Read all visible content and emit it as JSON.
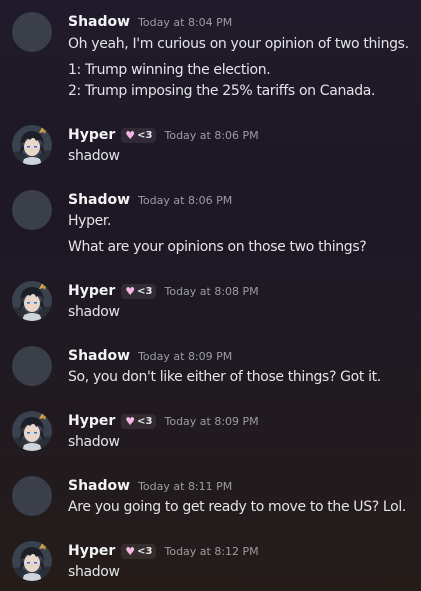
{
  "messages": [
    {
      "author": "Shadow",
      "timestamp": "Today at 8:04 PM",
      "lines": [
        "Oh yeah, I'm curious on your opinion of two things.",
        "1: Trump winning the election.",
        "2: Trump imposing the 25% tariffs on Canada."
      ]
    },
    {
      "author": "Hyper",
      "tag": "<3",
      "timestamp": "Today at 8:06 PM",
      "lines": [
        "shadow"
      ]
    },
    {
      "author": "Shadow",
      "timestamp": "Today at 8:06 PM",
      "lines": [
        "Hyper.",
        "What are your opinions on those two things?"
      ]
    },
    {
      "author": "Hyper",
      "tag": "<3",
      "timestamp": "Today at 8:08 PM",
      "lines": [
        "shadow"
      ]
    },
    {
      "author": "Shadow",
      "timestamp": "Today at 8:09 PM",
      "lines": [
        "So, you don't like either of those things? Got it."
      ]
    },
    {
      "author": "Hyper",
      "tag": "<3",
      "timestamp": "Today at 8:09 PM",
      "lines": [
        "shadow"
      ]
    },
    {
      "author": "Shadow",
      "timestamp": "Today at 8:11 PM",
      "lines": [
        "Are you going to get ready to move to the US? Lol."
      ]
    },
    {
      "author": "Hyper",
      "tag": "<3",
      "timestamp": "Today at 8:12 PM",
      "lines": [
        "shadow"
      ]
    }
  ],
  "colors": {
    "username": "#f2f3f5",
    "timestamp": "#9a9ca3",
    "text": "#e3e4e8",
    "heart": "#f5b7e6",
    "shadow_avatar": "#3b3f4a"
  },
  "icons": {
    "role_icon": "heart-icon"
  }
}
